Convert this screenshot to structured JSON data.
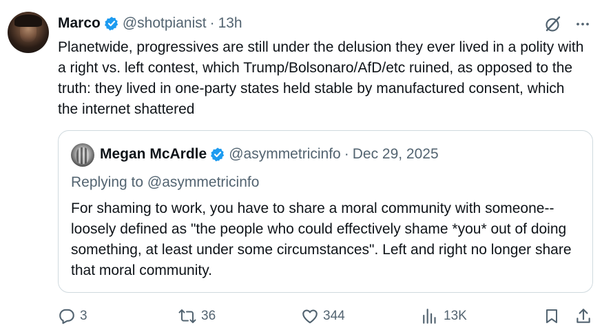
{
  "author": {
    "name": "Marco",
    "handle": "@shotpianist",
    "separator": "·",
    "time": "13h"
  },
  "tweet": {
    "text": "Planetwide, progressives are still under the delusion they ever lived in a polity with a right vs. left contest, which Trump/Bolsonaro/AfD/etc ruined, as opposed to the truth: they lived in one-party states held stable by manufactured consent, which the internet shattered"
  },
  "quote": {
    "name": "Megan McArdle",
    "handle": "@asymmetricinfo",
    "separator": "·",
    "date": "Dec 29, 2025",
    "replying_prefix": "Replying to",
    "replying_to": "@asymmetricinfo",
    "text": "For shaming to work, you have to share a moral community with someone--loosely defined as \"the people who could effectively shame *you* out of doing something, at least under some circumstances\". Left and right no longer share that moral community."
  },
  "actions": {
    "replies": "3",
    "reposts": "36",
    "likes": "344",
    "views": "13K"
  },
  "icons": {
    "verified_color": "#1d9bf0",
    "icon_color": "#536471"
  }
}
